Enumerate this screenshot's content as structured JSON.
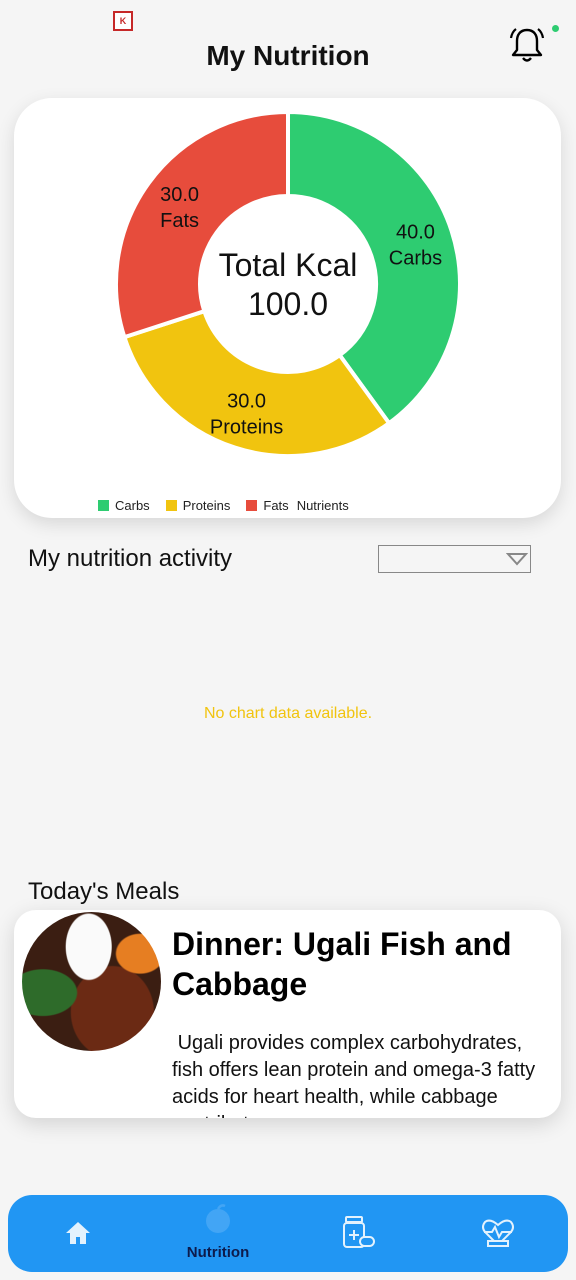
{
  "app": {
    "title": "My Nutrition",
    "badge": "K"
  },
  "pie": {
    "center_line1": "Total Kcal",
    "center_line2": "100.0",
    "slices": [
      {
        "value": "40.0",
        "label": "Carbs",
        "color": "#2ecc71"
      },
      {
        "value": "30.0",
        "label": "Proteins",
        "color": "#f1c40f"
      },
      {
        "value": "30.0",
        "label": "Fats",
        "color": "#e74c3c"
      }
    ],
    "legend_extra": "Nutrients"
  },
  "chart_data": {
    "type": "pie",
    "categories": [
      "Carbs",
      "Proteins",
      "Fats"
    ],
    "values": [
      40.0,
      30.0,
      30.0
    ],
    "title": "",
    "center_text": "Total Kcal 100.0",
    "legend_placement": "bottom-left",
    "colors": [
      "#2ecc71",
      "#f1c40f",
      "#e74c3c"
    ]
  },
  "activity": {
    "title": "My nutrition activity",
    "dropdown_value": "",
    "empty_text": "No chart data available."
  },
  "meals": {
    "title": "Today's Meals",
    "items": [
      {
        "title": "Dinner: Ugali Fish and Cabbage",
        "description": " Ugali provides complex carbohydrates, fish offers lean protein and omega-3 fatty acids for heart health, while cabbage contributes"
      }
    ]
  },
  "nav": {
    "items": [
      {
        "label": "",
        "icon": "home-icon"
      },
      {
        "label": "Nutrition",
        "icon": "nutrition-icon"
      },
      {
        "label": "",
        "icon": "medicine-icon"
      },
      {
        "label": "",
        "icon": "fitness-icon"
      }
    ]
  },
  "colors": {
    "accent": "#2196f3",
    "nav_text": "#0d1b4c",
    "empty_text": "#f1c40f"
  }
}
